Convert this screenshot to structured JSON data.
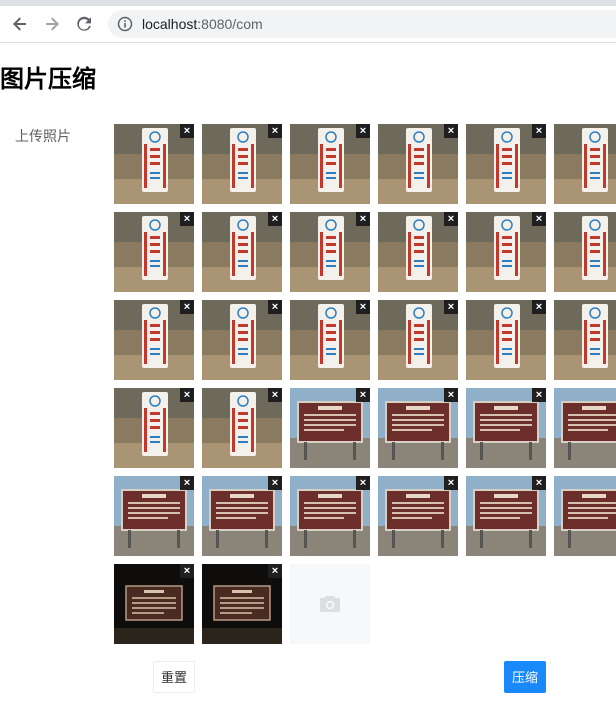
{
  "browser": {
    "url_host": "localhost",
    "url_rest": ":8080/com",
    "back_icon": "back-arrow-icon",
    "forward_icon": "forward-arrow-icon",
    "reload_icon": "reload-icon",
    "info_icon": "info-icon"
  },
  "page": {
    "title": "图片压缩"
  },
  "form": {
    "upload_label": "上传照片",
    "delete_glyph": "×",
    "upload_icon": "camera-icon",
    "photos": [
      {
        "kind": "marker"
      },
      {
        "kind": "marker"
      },
      {
        "kind": "marker"
      },
      {
        "kind": "marker"
      },
      {
        "kind": "marker"
      },
      {
        "kind": "marker"
      },
      {
        "kind": "marker"
      },
      {
        "kind": "marker"
      },
      {
        "kind": "marker"
      },
      {
        "kind": "marker"
      },
      {
        "kind": "marker"
      },
      {
        "kind": "marker"
      },
      {
        "kind": "marker"
      },
      {
        "kind": "marker"
      },
      {
        "kind": "marker"
      },
      {
        "kind": "marker"
      },
      {
        "kind": "marker"
      },
      {
        "kind": "marker"
      },
      {
        "kind": "marker"
      },
      {
        "kind": "marker"
      },
      {
        "kind": "signboard"
      },
      {
        "kind": "signboard"
      },
      {
        "kind": "signboard"
      },
      {
        "kind": "signboard"
      },
      {
        "kind": "signboard"
      },
      {
        "kind": "signboard"
      },
      {
        "kind": "signboard"
      },
      {
        "kind": "signboard"
      },
      {
        "kind": "signboard"
      },
      {
        "kind": "signboard"
      },
      {
        "kind": "night"
      },
      {
        "kind": "night"
      }
    ]
  },
  "actions": {
    "reset_label": "重置",
    "compress_label": "压缩"
  },
  "colors": {
    "primary": "#1989fa",
    "marker_red": "#c0392b",
    "sign_brown": "#6b2e2a"
  }
}
